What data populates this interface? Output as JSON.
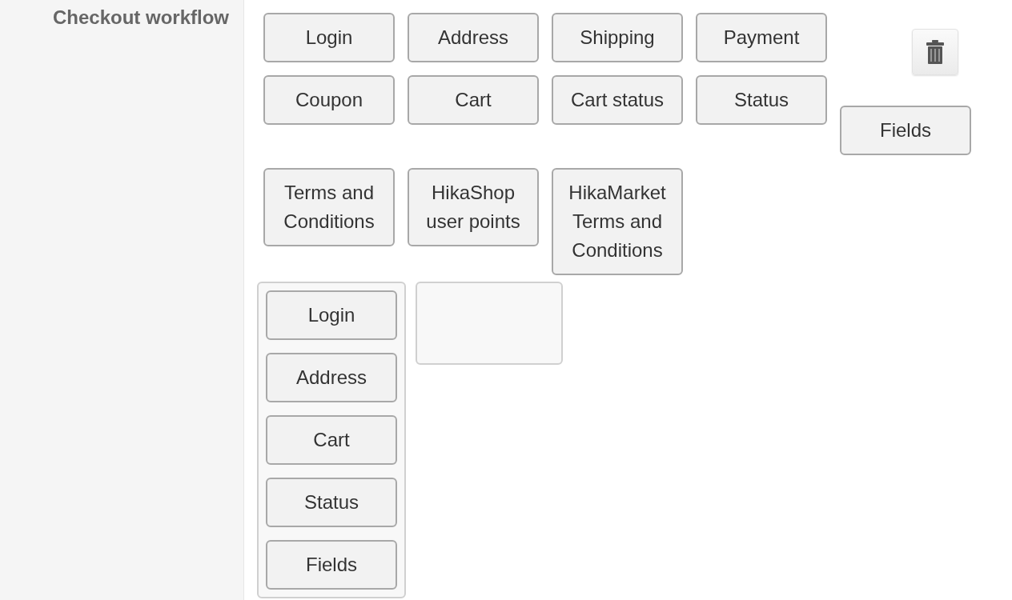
{
  "section_label": "Checkout workflow",
  "palette": {
    "blocks": [
      "Login",
      "Address",
      "Shipping",
      "Payment",
      "Coupon",
      "Cart",
      "Cart status",
      "Status"
    ],
    "side_block": "Fields",
    "more_blocks": [
      "Terms and Conditions",
      "HikaShop user points",
      "HikaMarket Terms and Conditions"
    ]
  },
  "steps": [
    {
      "kind": "filled",
      "blocks": [
        "Login",
        "Address",
        "Cart",
        "Status",
        "Fields"
      ]
    },
    {
      "kind": "empty"
    }
  ]
}
